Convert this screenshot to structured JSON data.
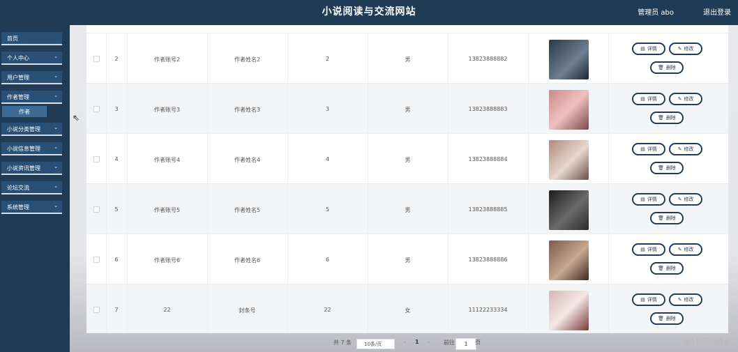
{
  "header": {
    "title": "小说阅读与交流网站",
    "user": "管理员 abo",
    "logout": "退出登录"
  },
  "sidebar": {
    "items": [
      {
        "label": "首页",
        "chevron": false
      },
      {
        "label": "个人中心",
        "chevron": true
      },
      {
        "label": "用户管理",
        "chevron": true
      },
      {
        "label": "作者管理",
        "chevron": true
      },
      {
        "label": "小说分类管理",
        "chevron": true
      },
      {
        "label": "小说信息管理",
        "chevron": true
      },
      {
        "label": "小说资讯管理",
        "chevron": true
      },
      {
        "label": "论坛交流",
        "chevron": true
      },
      {
        "label": "系统管理",
        "chevron": true
      }
    ],
    "submenu": {
      "label": "作者"
    }
  },
  "table": {
    "rows": [
      {
        "index": "2",
        "account": "作者账号2",
        "name": "作者姓名2",
        "num": "2",
        "gender": "男",
        "phone": "13823888882"
      },
      {
        "index": "3",
        "account": "作者账号3",
        "name": "作者姓名3",
        "num": "3",
        "gender": "男",
        "phone": "13823888883"
      },
      {
        "index": "4",
        "account": "作者账号4",
        "name": "作者姓名4",
        "num": "4",
        "gender": "男",
        "phone": "13823888884"
      },
      {
        "index": "5",
        "account": "作者账号5",
        "name": "作者姓名5",
        "num": "5",
        "gender": "男",
        "phone": "13823888885"
      },
      {
        "index": "6",
        "account": "作者账号6",
        "name": "作者姓名6",
        "num": "6",
        "gender": "男",
        "phone": "13823888886"
      },
      {
        "index": "7",
        "account": "22",
        "name": "封条号",
        "num": "22",
        "gender": "女",
        "phone": "11122233334"
      }
    ],
    "actions": {
      "detail": "详情",
      "edit": "修改",
      "delete": "删除"
    }
  },
  "pagination": {
    "total": "共 7 条",
    "page_size": "10条/页",
    "current_page": "1",
    "goto_label": "前往",
    "goto_value": "1",
    "goto_suffix": "页"
  },
  "watermark": "@51CTO博客"
}
